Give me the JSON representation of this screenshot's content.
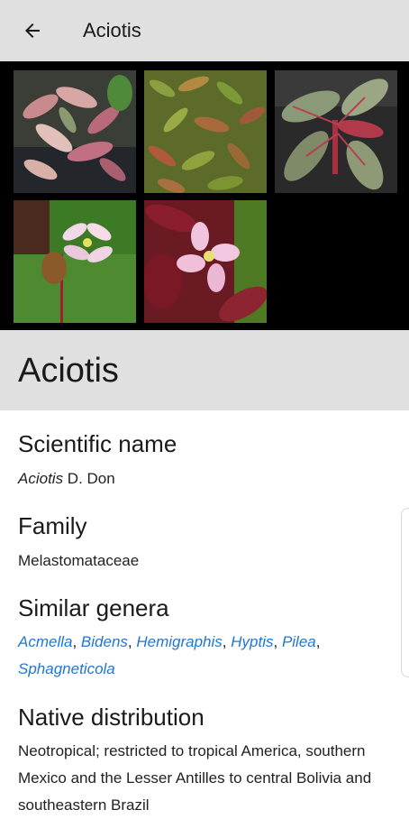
{
  "appbar": {
    "title": "Aciotis",
    "back_icon": "arrow-left-icon"
  },
  "gallery": {
    "photos": [
      {
        "subject": "variegated pink-green leaves"
      },
      {
        "subject": "dense green-red foliage"
      },
      {
        "subject": "green-red veined leaves"
      },
      {
        "subject": "pink flower with seed pod"
      },
      {
        "subject": "pink flower on red stems"
      }
    ]
  },
  "header": {
    "name": "Aciotis"
  },
  "scientific": {
    "heading": "Scientific name",
    "genus": "Aciotis",
    "author": " D. Don"
  },
  "family": {
    "heading": "Family",
    "value": "Melastomataceae"
  },
  "similar": {
    "heading": "Similar genera",
    "items": [
      "Acmella",
      "Bidens",
      "Hemigraphis",
      "Hyptis",
      "Pilea",
      "Sphagneticola"
    ],
    "separator": ", ",
    "link_color": "#1e77d4"
  },
  "distribution": {
    "heading": "Native distribution",
    "value": "Neotropical; restricted to tropical America, southern Mexico and the Lesser Antilles to central Bolivia and southeastern Brazil"
  }
}
